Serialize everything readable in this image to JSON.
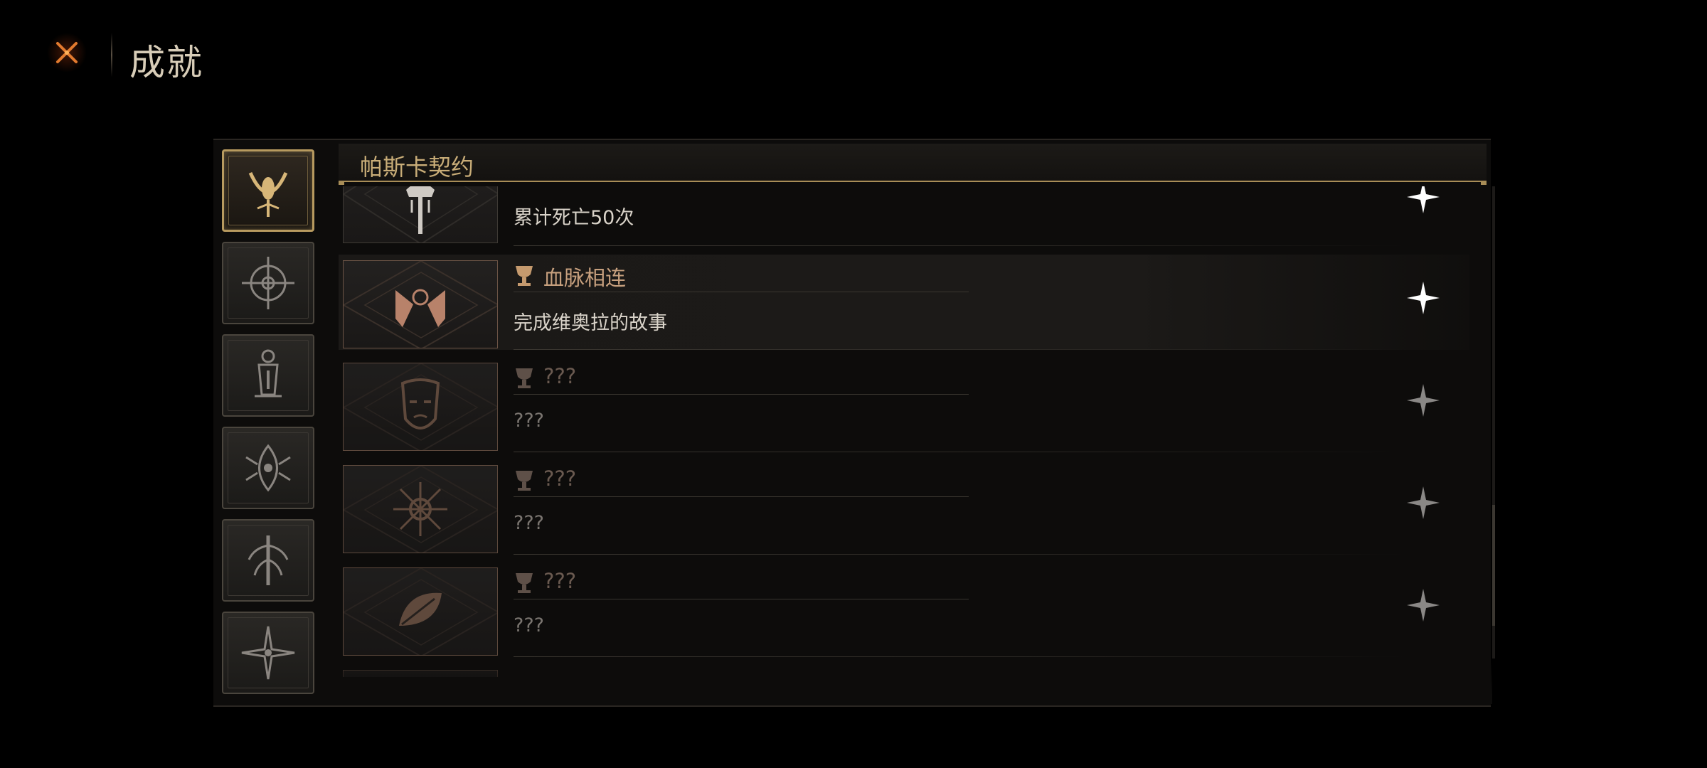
{
  "header": {
    "title": "成就",
    "close_icon": "close-x-icon"
  },
  "colors": {
    "accent_gold": "#b79a5f",
    "unlocked_name": "#c7a07e",
    "locked_name": "#6a5a50",
    "star_unlocked": "#ffffff",
    "star_locked": "#8a8886"
  },
  "tabs": [
    {
      "icon": "eye-crescent-icon",
      "active": true
    },
    {
      "icon": "compass-sigil-icon",
      "active": false
    },
    {
      "icon": "lantern-sigil-icon",
      "active": false
    },
    {
      "icon": "thorn-eye-icon",
      "active": false
    },
    {
      "icon": "tree-sigil-icon",
      "active": false
    },
    {
      "icon": "starburst-sigil-icon",
      "active": false
    }
  ],
  "category": {
    "title": "帕斯卡契约"
  },
  "achievements": [
    {
      "name": "",
      "description": "累计死亡50次",
      "unlocked": true,
      "icon": "bleeding-sword-icon",
      "partial_top": true
    },
    {
      "name": "血脉相连",
      "description": "完成维奥拉的故事",
      "unlocked": true,
      "icon": "twin-figures-icon"
    },
    {
      "name": "???",
      "description": "???",
      "unlocked": false,
      "icon": "mask-icon"
    },
    {
      "name": "???",
      "description": "???",
      "unlocked": false,
      "icon": "radiant-sun-icon"
    },
    {
      "name": "???",
      "description": "???",
      "unlocked": false,
      "icon": "leaf-icon"
    }
  ]
}
